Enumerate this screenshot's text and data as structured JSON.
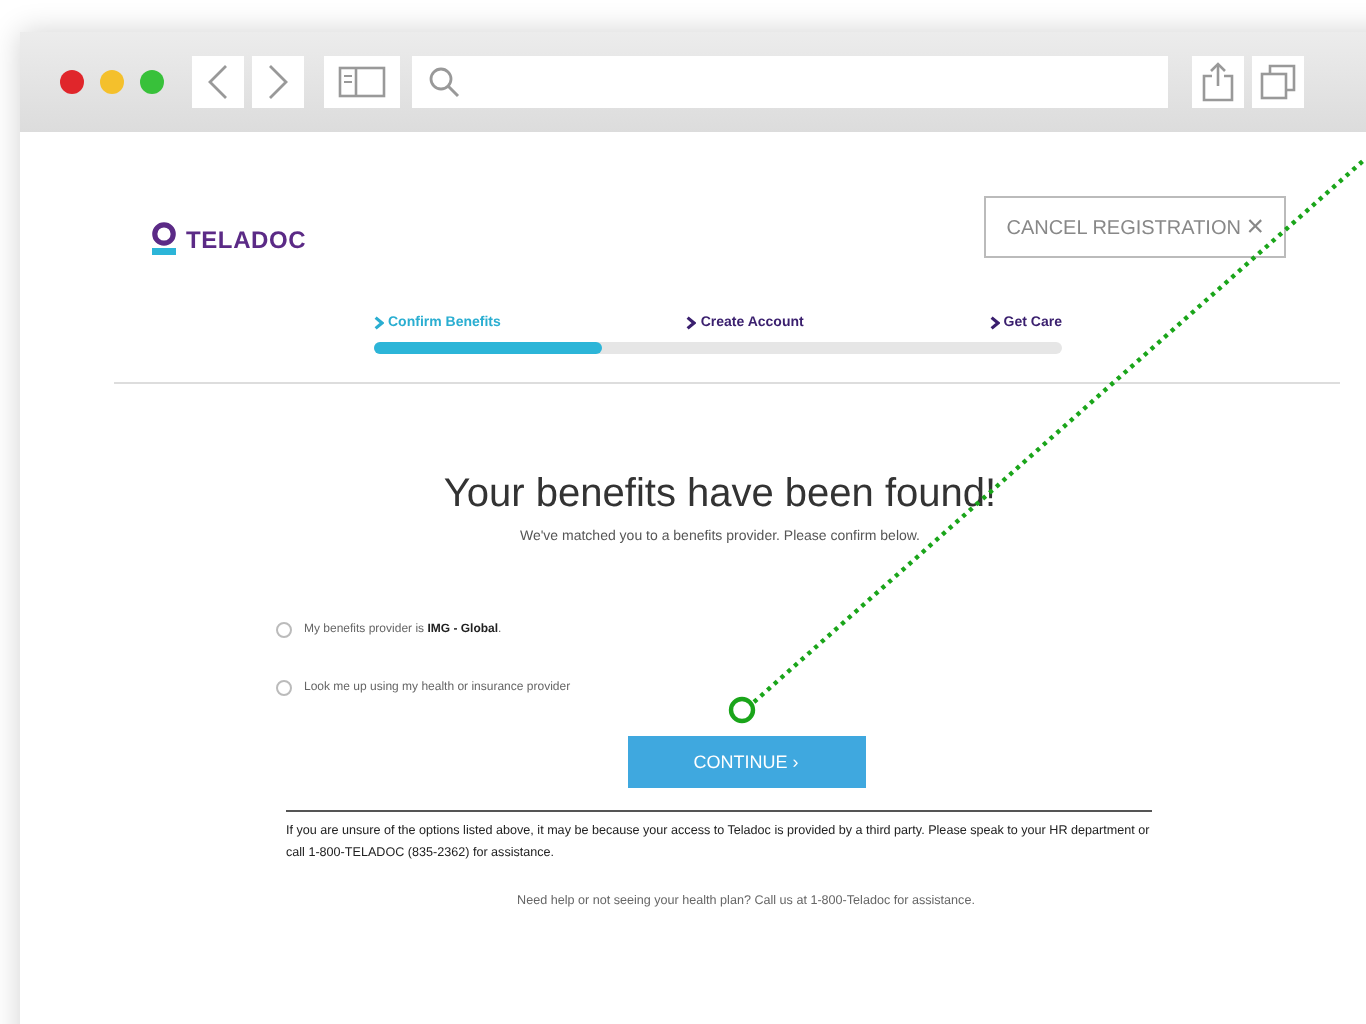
{
  "brand": {
    "name": "TELADOC"
  },
  "cancel_button": {
    "label": "CANCEL REGISTRATION",
    "icon": "×"
  },
  "steps": [
    {
      "label": "Confirm Benefits",
      "selected": true
    },
    {
      "label": "Create Account",
      "selected": false
    },
    {
      "label": "Get Care",
      "selected": false
    }
  ],
  "progress": {
    "level": 0.33
  },
  "heading": "Your benefits have been found!",
  "subheading": "We've matched you to a benefits provider. Please confirm below.",
  "options": [
    {
      "label": "My benefits provider is **IMG - Global**.",
      "checked": false
    },
    {
      "label": "Look me up using my health or insurance provider",
      "checked": false
    }
  ],
  "continue_button": {
    "label": "CONTINUE ›"
  },
  "note": "If you are unsure of the options listed above, it may be because your access to Teladoc is provided by a third party. Please speak to your HR department or call 1-800-TELADOC (835-2362) for assistance.",
  "help": "Need help or not seeing your health plan? Call us at 1-800-Teladoc for assistance."
}
